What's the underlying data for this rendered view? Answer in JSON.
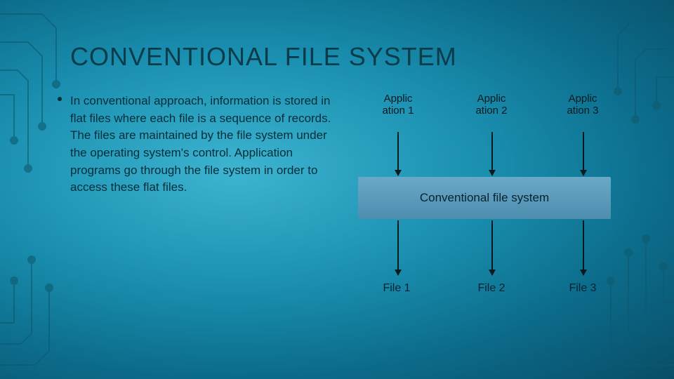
{
  "title": "CONVENTIONAL FILE SYSTEM",
  "bullet": "In conventional approach, information is stored in flat files where each file is a sequence of records. The files are maintained by the file system under the operating system's control. Application programs go through the file system in order to access these flat files.",
  "diagram": {
    "apps": [
      "Applic ation 1",
      "Applic ation 2",
      "Applic ation 3"
    ],
    "middle": "Conventional file system",
    "files": [
      "File 1",
      "File 2",
      "File 3"
    ]
  }
}
